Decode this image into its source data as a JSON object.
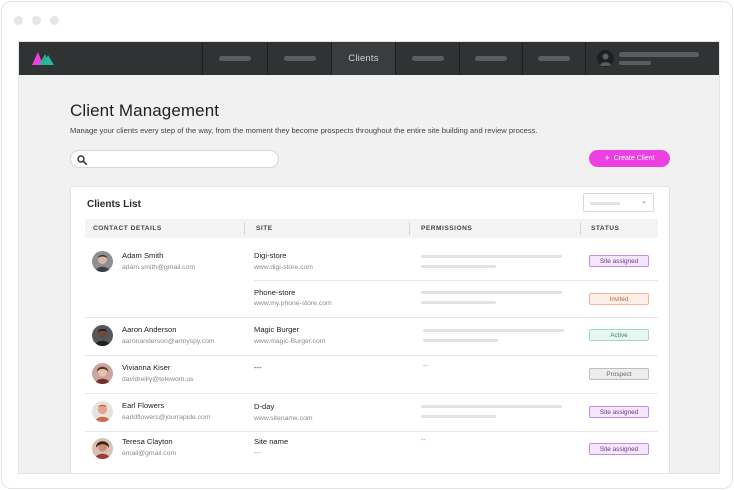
{
  "nav": {
    "active_item": "Clients",
    "colors": {
      "background": "#2f3334",
      "logo_pink": "#ee3fe0",
      "logo_teal": "#2bb59a"
    }
  },
  "header": {
    "title": "Client Management",
    "subtitle": "Manage your clients every step of the way, from the moment they become prospects throughout the entire site building and review process."
  },
  "toolbar": {
    "search_icon": "search-icon",
    "create_label": "Create Client",
    "create_icon": "plus-icon",
    "accent": "#ee3fe0"
  },
  "clients_list": {
    "title": "Clients List",
    "columns": [
      "CONTACT DETAILS",
      "SITE",
      "PERMISSIONS",
      "STATUS"
    ],
    "rows": [
      {
        "name": "Adam Smith",
        "email": "adam.smith@gmail.com",
        "site": "Digi-store",
        "url": "www.digi-store.com",
        "permissions": "",
        "status": "Site assigned"
      },
      {
        "name": "",
        "email": "",
        "site": "Phone-store",
        "url": "www.my.phone-store.com",
        "permissions": "",
        "status": "Invited"
      },
      {
        "name": "Aaron Anderson",
        "email": "aaronanderson@armyspy.com",
        "site": "Magic Burger",
        "url": "www.magic-Burger.com",
        "permissions": "",
        "status": "Active"
      },
      {
        "name": "Vivianna Kiser",
        "email": "davidreilly@telewom.us",
        "site": "---",
        "url": "",
        "permissions": "--",
        "status": "Prospect"
      },
      {
        "name": "Earl Flowers",
        "email": "earldflowers@jourrapide.com",
        "site": "D-day",
        "url": "www.sitename.com",
        "permissions": "",
        "status": "Site assigned"
      },
      {
        "name": "Teresa Clayton",
        "email": "email@gmail.com",
        "site": "Site name",
        "url": "---",
        "permissions": "--",
        "status": "Site assigned"
      }
    ]
  }
}
